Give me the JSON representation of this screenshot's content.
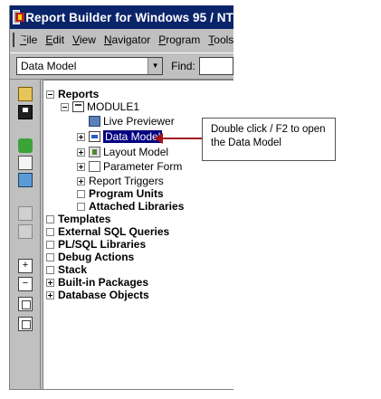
{
  "window": {
    "title": "Report Builder for Windows 95 / NT"
  },
  "menubar": {
    "items": [
      {
        "first": "F",
        "rest": "ile"
      },
      {
        "first": "E",
        "rest": "dit"
      },
      {
        "first": "V",
        "rest": "iew"
      },
      {
        "first": "N",
        "rest": "avigator"
      },
      {
        "first": "P",
        "rest": "rogram"
      },
      {
        "first": "T",
        "rest": "ools"
      }
    ]
  },
  "toolbar": {
    "combo_value": "Data Model",
    "find_label": "Find:",
    "find_value": ""
  },
  "sidebar": {
    "icons": [
      "open-icon",
      "save-icon",
      "run-icon",
      "print-icon",
      "preview-icon",
      "create-icon",
      "delete-icon",
      "expand-icon",
      "collapse-icon",
      "expand-all-icon",
      "collapse-all-icon"
    ]
  },
  "navigator": {
    "reports": "Reports",
    "module": "MODULE1",
    "live_previewer": "Live Previewer",
    "data_model": "Data Model",
    "layout_model": "Layout Model",
    "parameter_form": "Parameter Form",
    "report_triggers": "Report Triggers",
    "program_units": "Program Units",
    "attached_libraries": "Attached Libraries",
    "templates": "Templates",
    "external_sql": "External SQL Queries",
    "plsql_libraries": "PL/SQL Libraries",
    "debug_actions": "Debug Actions",
    "stack": "Stack",
    "builtin_packages": "Built-in Packages",
    "database_objects": "Database Objects"
  },
  "callout": {
    "text": "Double click / F2 to open the Data Model"
  },
  "colors": {
    "titlebar": "#0a246a",
    "selection": "#000080",
    "arrow": "#a0151a"
  }
}
